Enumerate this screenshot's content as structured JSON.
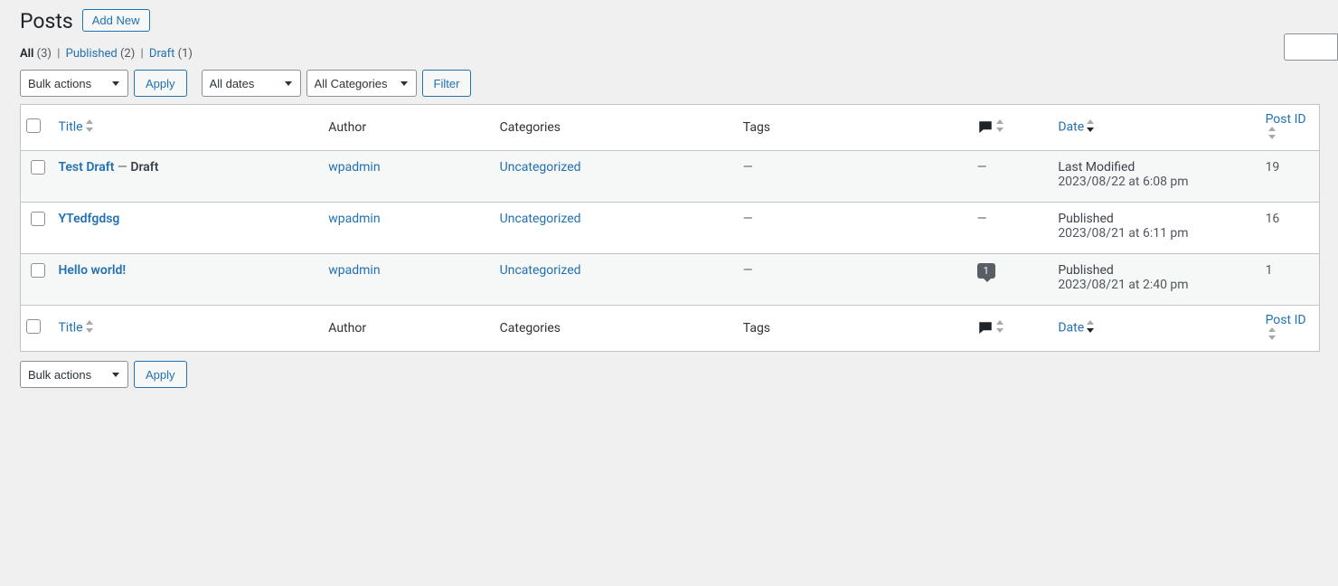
{
  "header": {
    "title": "Posts",
    "addnew": "Add New"
  },
  "filters": {
    "all_label": "All",
    "all_count": "(3)",
    "published_label": "Published",
    "published_count": "(2)",
    "draft_label": "Draft",
    "draft_count": "(1)",
    "bulk_actions": "Bulk actions",
    "apply": "Apply",
    "all_dates": "All dates",
    "all_categories": "All Categories",
    "filter": "Filter"
  },
  "columns": {
    "title": "Title",
    "author": "Author",
    "categories": "Categories",
    "tags": "Tags",
    "date": "Date",
    "postid": "Post ID"
  },
  "rows": [
    {
      "title": "Test Draft",
      "state_sep": " — ",
      "state": "Draft",
      "author": "wpadmin",
      "categories": "Uncategorized",
      "tags": "—",
      "comments_display": "—",
      "comments_count": null,
      "date_status": "Last Modified",
      "date_value": "2023/08/22 at 6:08 pm",
      "postid": "19"
    },
    {
      "title": "YTedfgdsg",
      "state_sep": "",
      "state": "",
      "author": "wpadmin",
      "categories": "Uncategorized",
      "tags": "—",
      "comments_display": "—",
      "comments_count": null,
      "date_status": "Published",
      "date_value": "2023/08/21 at 6:11 pm",
      "postid": "16"
    },
    {
      "title": "Hello world!",
      "state_sep": "",
      "state": "",
      "author": "wpadmin",
      "categories": "Uncategorized",
      "tags": "—",
      "comments_display": "",
      "comments_count": "1",
      "date_status": "Published",
      "date_value": "2023/08/21 at 2:40 pm",
      "postid": "1"
    }
  ]
}
